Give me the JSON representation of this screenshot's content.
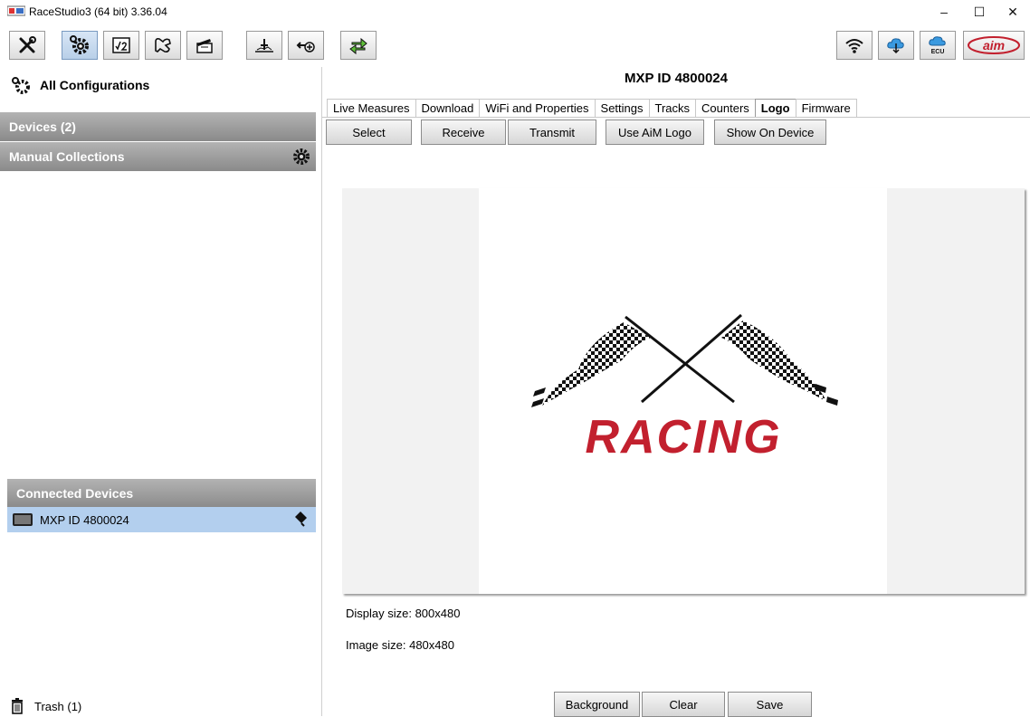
{
  "window": {
    "title": "RaceStudio3 (64 bit) 3.36.04",
    "minimize": "–",
    "maximize": "☐",
    "close": "✕"
  },
  "toolbar": {
    "left_icons": [
      "tools-icon",
      "configuration-gear-icon",
      "math-channels-icon",
      "track-map-icon",
      "video-clapper-icon",
      "data-analysis-icon",
      "add-device-icon",
      "transfer-icon"
    ],
    "right_icons": [
      "wifi-icon",
      "cloud-download-icon",
      "cloud-ecu-icon",
      "aim-logo"
    ],
    "ecu_label": "ECU",
    "aim_logo_text": "aim"
  },
  "sidebar": {
    "all_configurations": "All Configurations",
    "devices": "Devices  (2)",
    "manual_collections": "Manual Collections",
    "connected_devices": "Connected Devices",
    "device_item": "MXP ID 4800024",
    "trash": "Trash (1)"
  },
  "main": {
    "device_title": "MXP ID 4800024",
    "tabs": [
      {
        "label": "Live Measures"
      },
      {
        "label": "Download"
      },
      {
        "label": "WiFi and Properties"
      },
      {
        "label": "Settings"
      },
      {
        "label": "Tracks"
      },
      {
        "label": "Counters"
      },
      {
        "label": "Logo",
        "active": true
      },
      {
        "label": "Firmware"
      }
    ],
    "actions": {
      "select": "Select",
      "receive": "Receive",
      "transmit": "Transmit",
      "use_aim_logo": "Use AiM Logo",
      "show_on_device": "Show On Device"
    },
    "logo_text": "RACING",
    "display_size": "Display size: 800x480",
    "image_size": "Image size: 480x480",
    "bottom": {
      "background": "Background",
      "clear": "Clear",
      "save": "Save"
    }
  },
  "colors": {
    "selected_row": "#b3cfee",
    "section_bar": "#9e9e9e",
    "logo_red": "#c2202e"
  }
}
